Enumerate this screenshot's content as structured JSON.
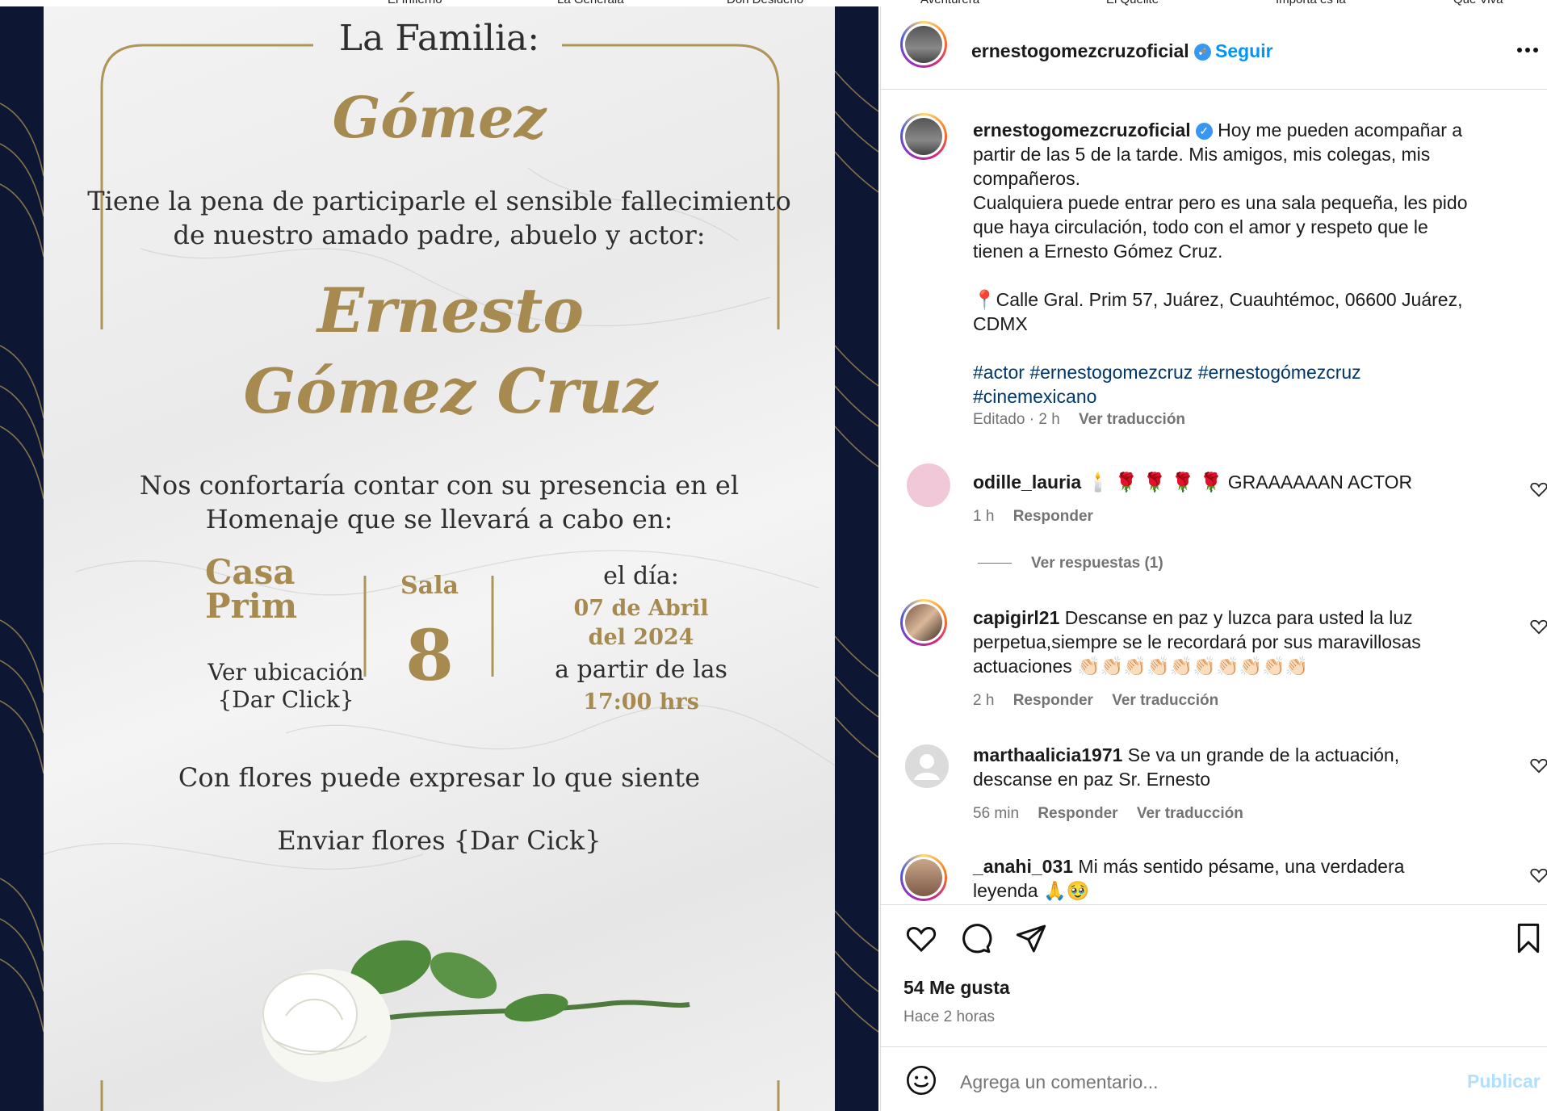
{
  "top_strip": [
    "El Infierno",
    "La Generala",
    "Don Desiderio",
    "Aventurera",
    "El Quelite",
    "Importa es la",
    "Que Viva"
  ],
  "invitation": {
    "family_label": "La Familia:",
    "family_name": "Gómez",
    "notice_line1": "Tiene la pena de participarle el sensible fallecimiento",
    "notice_line2": "de nuestro amado padre, abuelo y actor:",
    "name_line1": "Ernesto",
    "name_line2": "Gómez Cruz",
    "comfort_line1": "Nos confortaría contar con su presencia en el",
    "comfort_line2": "Homenaje que se llevará a cabo en:",
    "venue_line1": "Casa",
    "venue_line2": "Prim",
    "location_line1": "Ver ubicación",
    "location_line2": "{Dar Click}",
    "room_label": "Sala",
    "room_number": "8",
    "day_label": "el día:",
    "date_line1": "07 de Abril",
    "date_line2": "del 2024",
    "from_label": "a partir de las",
    "time": "17:00 hrs",
    "flowers_line": "Con flores puede expresar lo que siente",
    "send_flowers": "Enviar flores {Dar Cick}"
  },
  "post": {
    "username": "ernestogomezcruzoficial",
    "follow_label": "Seguir",
    "caption_lines": [
      "Hoy me pueden acompañar a",
      "partir de las 5 de la tarde. Mis amigos, mis colegas, mis",
      "compañeros.",
      "Cualquiera puede entrar pero es una sala pequeña, les pido",
      "que haya circulación, todo con el amor y respeto que le",
      "tienen a Ernesto Gómez Cruz."
    ],
    "address_line1": "Calle Gral. Prim 57, Juárez, Cuauhtémoc, 06600 Juárez,",
    "address_line2": "CDMX",
    "hashtags_line1": "#actor #ernestogomezcruz #ernestogómezcruz",
    "hashtags_line2": "#cinemexicano",
    "edited_label": "Editado",
    "edited_time": "2 h",
    "translate_label": "Ver traducción"
  },
  "comments": [
    {
      "user": "odille_lauria",
      "text_lines": [
        "🕯️ 🌹 🌹 🌹 🌹 GRAAAAAAN ACTOR"
      ],
      "time": "1 h",
      "reply": "Responder",
      "translate": "",
      "view_replies": "Ver respuestas (1)"
    },
    {
      "user": "capigirl21",
      "text_lines": [
        "Descanse en paz y luzca para usted la luz",
        "perpetua,siempre se le recordará por sus maravillosas",
        "actuaciones 👏🏻👏🏻👏🏻👏🏻👏🏻👏🏻👏🏻👏🏻👏🏻👏🏻"
      ],
      "time": "2 h",
      "reply": "Responder",
      "translate": "Ver traducción"
    },
    {
      "user": "marthaalicia1971",
      "text_lines": [
        "Se va un grande de la actuación,",
        "descanse en paz Sr. Ernesto"
      ],
      "time": "56 min",
      "reply": "Responder",
      "translate": "Ver traducción"
    },
    {
      "user": "_anahi_031",
      "text_lines": [
        "Mi más sentido pésame, una verdadera",
        "leyenda 🙏🥹"
      ],
      "time": "",
      "reply": "",
      "translate": ""
    }
  ],
  "likes_label": "54 Me gusta",
  "posted_time": "Hace 2 horas",
  "comment_placeholder": "Agrega un comentario...",
  "publish_label": "Publicar",
  "icons": [
    "heart-icon",
    "comment-icon",
    "share-icon",
    "bookmark-icon",
    "more-icon",
    "emoji-icon",
    "verified-icon",
    "pin-icon"
  ],
  "colors": {
    "link_blue": "#0095f6",
    "hashtag": "#00376b",
    "gold": "#a68a50",
    "navy": "#0d1733",
    "verified": "#3897f0"
  }
}
